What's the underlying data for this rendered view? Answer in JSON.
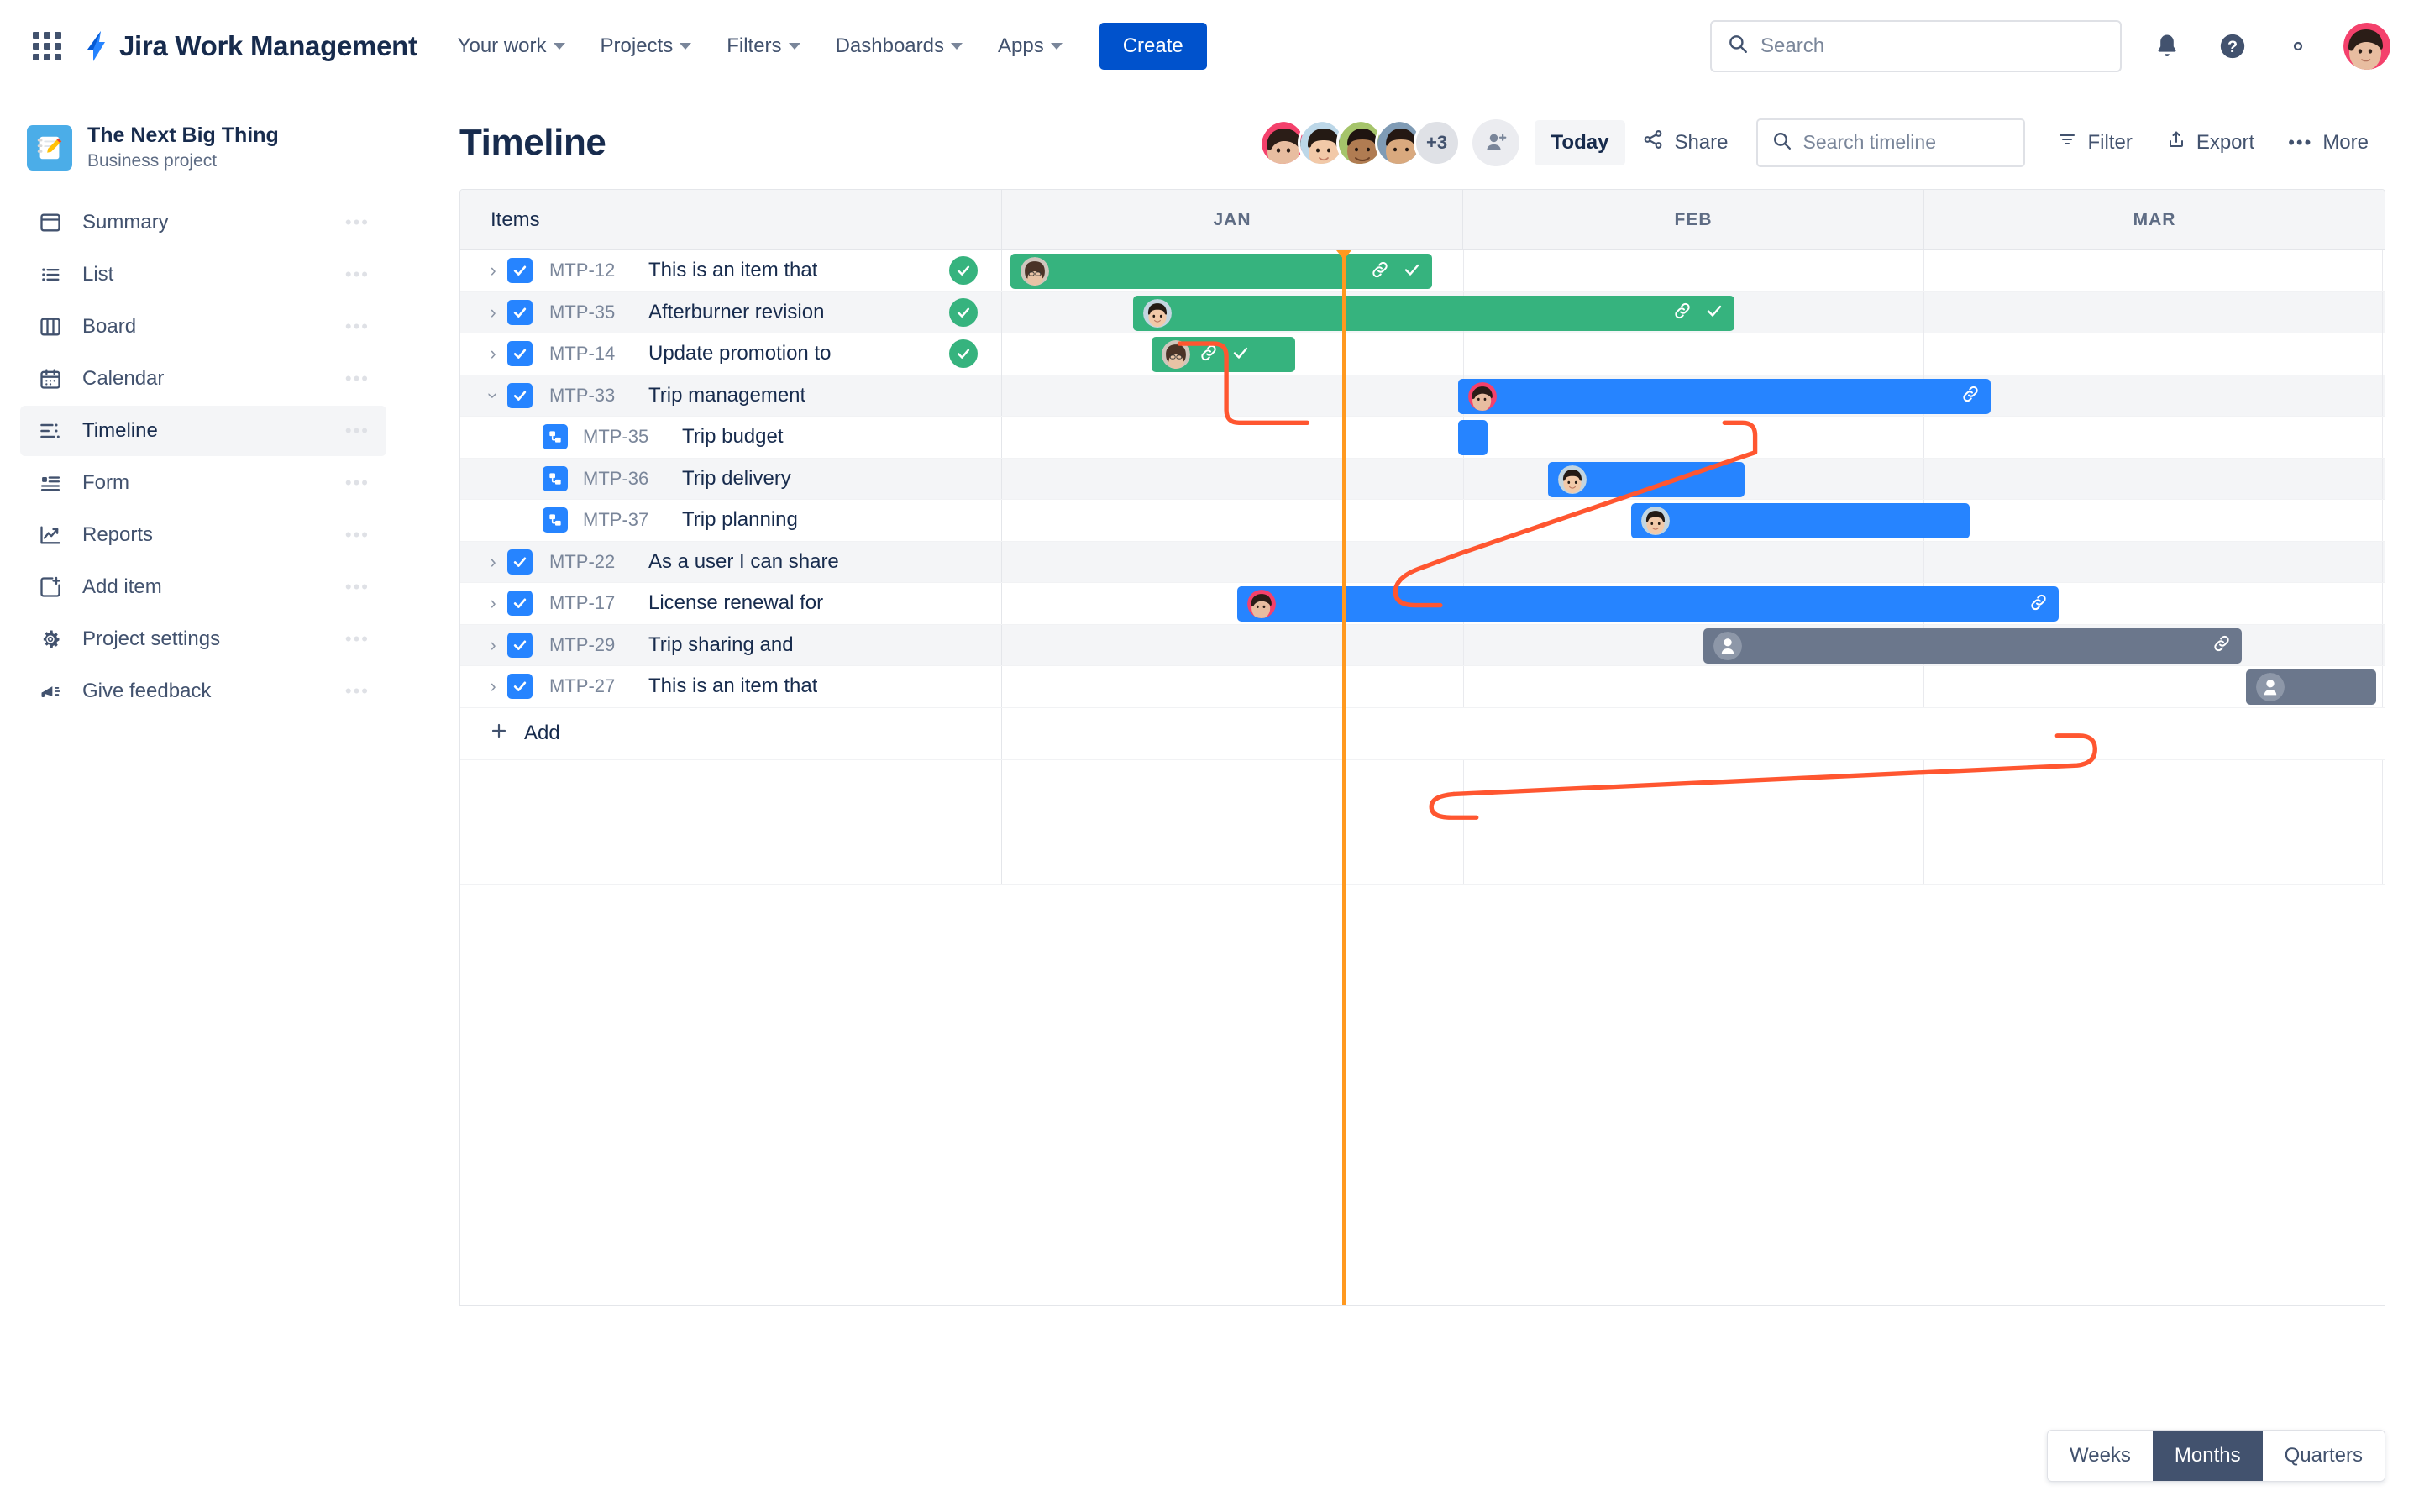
{
  "topnav": {
    "app_switcher_icon": "grid-apps-icon",
    "brand": "Jira Work Management",
    "nav": [
      {
        "label": "Your work",
        "icon": "chevron-down-icon"
      },
      {
        "label": "Projects",
        "icon": "chevron-down-icon"
      },
      {
        "label": "Filters",
        "icon": "chevron-down-icon"
      },
      {
        "label": "Dashboards",
        "icon": "chevron-down-icon"
      },
      {
        "label": "Apps",
        "icon": "chevron-down-icon"
      }
    ],
    "create_label": "Create",
    "search_placeholder": "Search",
    "search_value": "",
    "icons": [
      "notifications-bell-icon",
      "help-question-icon",
      "settings-gear-icon",
      "user-avatar"
    ]
  },
  "sidebar": {
    "project_name": "The Next Big Thing",
    "project_type": "Business project",
    "project_icon": "notepad-pencil-icon",
    "items": [
      {
        "label": "Summary",
        "icon": "summary-window-icon",
        "active": false
      },
      {
        "label": "List",
        "icon": "list-bullets-icon",
        "active": false
      },
      {
        "label": "Board",
        "icon": "board-columns-icon",
        "active": false
      },
      {
        "label": "Calendar",
        "icon": "calendar-icon",
        "active": false
      },
      {
        "label": "Timeline",
        "icon": "timeline-bars-icon",
        "active": true
      },
      {
        "label": "Form",
        "icon": "form-icon",
        "active": false
      },
      {
        "label": "Reports",
        "icon": "reports-chart-icon",
        "active": false
      },
      {
        "label": "Add item",
        "icon": "add-item-icon",
        "active": false
      },
      {
        "label": "Project settings",
        "icon": "settings-gear-icon",
        "active": false
      },
      {
        "label": "Give feedback",
        "icon": "megaphone-icon",
        "active": false
      }
    ],
    "overflow_dots": "•••"
  },
  "main": {
    "title": "Timeline",
    "avatar_overflow": "+3",
    "add_person_icon": "add-person-icon",
    "today_label": "Today",
    "share_label": "Share",
    "share_icon": "share-icon",
    "search_placeholder": "Search timeline",
    "search_value": "",
    "filter_label": "Filter",
    "filter_icon": "filter-icon",
    "export_label": "Export",
    "export_icon": "export-upload-icon",
    "more_label": "More",
    "more_icon": "more-dots-icon"
  },
  "gantt": {
    "items_header": "Items",
    "months": [
      "JAN",
      "FEB",
      "MAR"
    ],
    "add_label": "Add",
    "add_icon": "plus-icon",
    "today_marker": "today-line",
    "rows": [
      {
        "key": "MTP-12",
        "summary": "This is an item that",
        "type": "task",
        "twisty": "collapsed",
        "done": true,
        "bar": {
          "color": "green",
          "left": 0.6,
          "width": 30.5,
          "avatar": "brunette-glasses",
          "link": true,
          "check": true,
          "icons_inline": false
        }
      },
      {
        "key": "MTP-35",
        "summary": "Afterburner revision",
        "type": "task",
        "twisty": "collapsed",
        "done": true,
        "bar": {
          "color": "green",
          "left": 9.5,
          "width": 43.5,
          "avatar": "dark-bob",
          "link": true,
          "check": true,
          "icons_inline": false
        }
      },
      {
        "key": "MTP-14",
        "summary": "Update promotion to",
        "type": "task",
        "twisty": "collapsed",
        "done": true,
        "bar": {
          "color": "green",
          "left": 10.8,
          "width": 10.4,
          "avatar": "brunette-glasses",
          "link": true,
          "check": true,
          "icons_inline": true
        }
      },
      {
        "key": "MTP-33",
        "summary": "Trip management",
        "type": "task",
        "twisty": "expanded",
        "done": false,
        "bar": {
          "color": "blue",
          "left": 33.0,
          "width": 38.5,
          "avatar": "pink-hair",
          "link": true,
          "check": false,
          "icons_inline": false
        }
      },
      {
        "key": "MTP-35",
        "summary": "Trip budget",
        "type": "subtask",
        "twisty": "none",
        "done": false,
        "bar": {
          "color": "blue",
          "left": 33.0,
          "width": 2.1,
          "avatar": "",
          "link": false,
          "check": false,
          "icons_inline": false
        }
      },
      {
        "key": "MTP-36",
        "summary": "Trip delivery",
        "type": "subtask",
        "twisty": "none",
        "done": false,
        "bar": {
          "color": "blue",
          "left": 39.5,
          "width": 14.2,
          "avatar": "dark-bob",
          "link": false,
          "check": false,
          "icons_inline": false
        }
      },
      {
        "key": "MTP-37",
        "summary": "Trip planning",
        "type": "subtask",
        "twisty": "none",
        "done": false,
        "bar": {
          "color": "blue",
          "left": 45.5,
          "width": 24.5,
          "avatar": "dark-bob",
          "link": false,
          "check": false,
          "icons_inline": false
        }
      },
      {
        "key": "MTP-22",
        "summary": "As a user I can share",
        "type": "task",
        "twisty": "collapsed",
        "done": false,
        "bar": null
      },
      {
        "key": "MTP-17",
        "summary": "License renewal for",
        "type": "task",
        "twisty": "collapsed",
        "done": false,
        "bar": {
          "color": "blue",
          "left": 17.0,
          "width": 59.4,
          "avatar": "pink-hair",
          "link": true,
          "check": false,
          "icons_inline": false
        }
      },
      {
        "key": "MTP-29",
        "summary": "Trip sharing and",
        "type": "task",
        "twisty": "collapsed",
        "done": false,
        "bar": {
          "color": "gray",
          "left": 50.7,
          "width": 39.0,
          "avatar": "anonymous",
          "link": true,
          "check": false,
          "icons_inline": false
        }
      },
      {
        "key": "MTP-27",
        "summary": "This is an item that",
        "type": "task",
        "twisty": "collapsed",
        "done": false,
        "bar": {
          "color": "gray",
          "left": 90.0,
          "width": 9.4,
          "avatar": "anonymous",
          "link": false,
          "check": false,
          "icons_inline": false
        }
      }
    ]
  },
  "zoom_toggle": {
    "options": [
      "Weeks",
      "Months",
      "Quarters"
    ],
    "selected": "Months"
  },
  "colors": {
    "brand_blue": "#0052cc",
    "bar_blue": "#2684ff",
    "bar_green": "#36b37e",
    "bar_gray": "#6b778c",
    "today_orange": "#ff991f",
    "dependency_red": "#ff5630",
    "text_dark": "#172b4d",
    "text_subtle": "#5e6c84"
  }
}
